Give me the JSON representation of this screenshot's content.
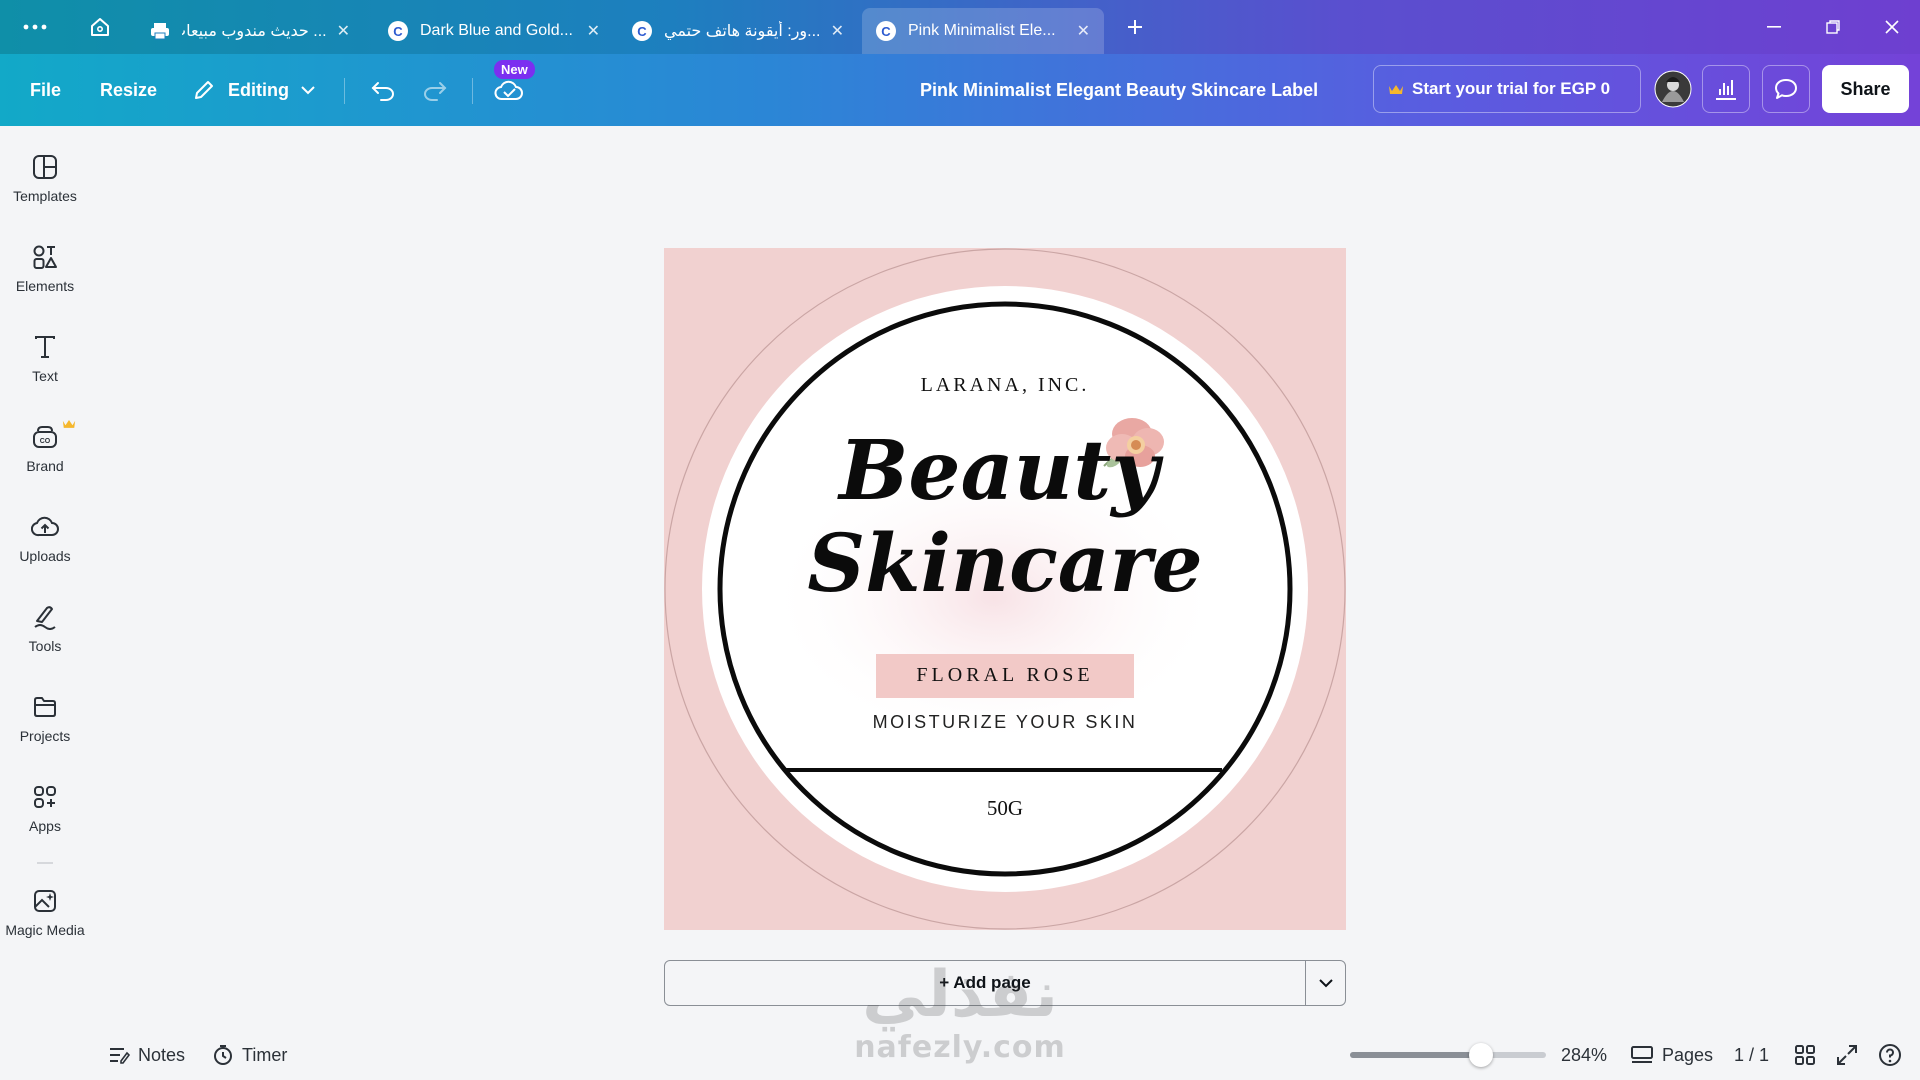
{
  "tabs": [
    {
      "title": "... حديث مندوب مبيعات",
      "active": false
    },
    {
      "title": "Dark Blue and Gold...",
      "active": false
    },
    {
      "title": "...ور: أيقونة هاتف حتمي",
      "active": false
    },
    {
      "title": "Pink Minimalist Ele...",
      "active": true
    }
  ],
  "toolbar": {
    "file": "File",
    "resize": "Resize",
    "editing": "Editing",
    "new_badge": "New",
    "doc_title": "Pink Minimalist Elegant Beauty Skincare Label",
    "trial": "Start your trial for EGP 0",
    "share": "Share"
  },
  "sidebar": [
    {
      "label": "Templates",
      "icon": "templates-icon"
    },
    {
      "label": "Elements",
      "icon": "elements-icon"
    },
    {
      "label": "Text",
      "icon": "text-icon"
    },
    {
      "label": "Brand",
      "icon": "brand-icon"
    },
    {
      "label": "Uploads",
      "icon": "uploads-icon"
    },
    {
      "label": "Tools",
      "icon": "tools-icon"
    },
    {
      "label": "Projects",
      "icon": "projects-icon"
    },
    {
      "label": "Apps",
      "icon": "apps-icon"
    },
    {
      "label": "Magic Media",
      "icon": "magic-media-icon"
    }
  ],
  "design": {
    "company": "LARANA, INC.",
    "title_line1": "Beauty",
    "title_line2": "Skincare",
    "product": "FLORAL ROSE",
    "tagline": "MOISTURIZE YOUR SKIN",
    "weight": "50G"
  },
  "add_page": "+ Add page",
  "status": {
    "notes": "Notes",
    "timer": "Timer",
    "zoom": "284%",
    "zoom_level": 0.67,
    "pages": "Pages",
    "page_count": "1 / 1"
  },
  "watermark": {
    "line1": "نفذلي",
    "line2": "nafezly.com"
  },
  "colors": {
    "label_bg": "#f1d1d0",
    "band": "#f2c9c7",
    "accent": "#7b2ff0"
  }
}
